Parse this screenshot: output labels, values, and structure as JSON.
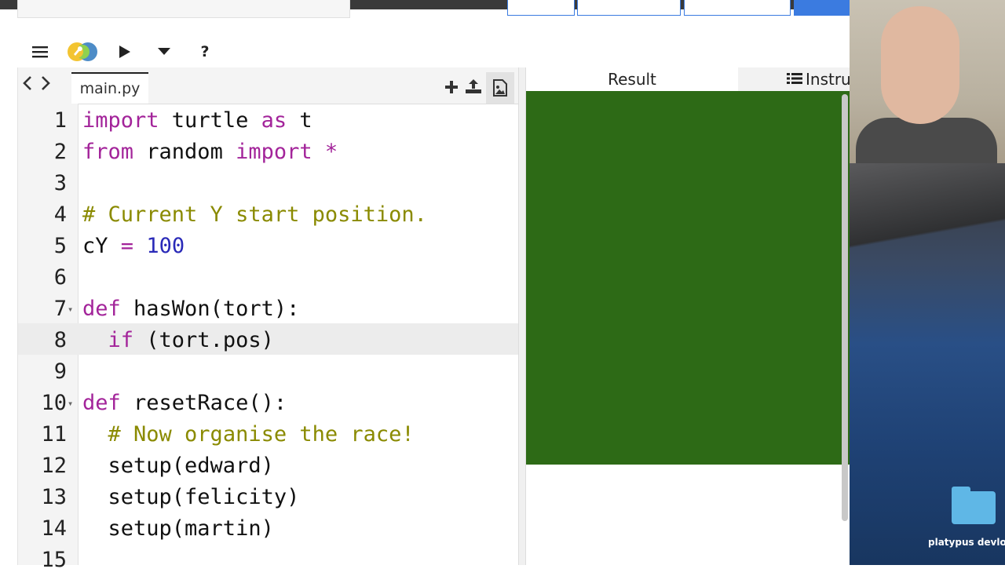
{
  "editor": {
    "filename": "main.py",
    "lines": [
      {
        "n": "1",
        "code": "import turtle as t"
      },
      {
        "n": "2",
        "code": "from random import *"
      },
      {
        "n": "3",
        "code": ""
      },
      {
        "n": "4",
        "code": "# Current Y start position."
      },
      {
        "n": "5",
        "code": "cY = 100"
      },
      {
        "n": "6",
        "code": ""
      },
      {
        "n": "7",
        "code": "def hasWon(tort):"
      },
      {
        "n": "8",
        "code": "  if (tort.pos)"
      },
      {
        "n": "9",
        "code": ""
      },
      {
        "n": "10",
        "code": "def resetRace():"
      },
      {
        "n": "11",
        "code": "  # Now organise the race!"
      },
      {
        "n": "12",
        "code": "  setup(edward)"
      },
      {
        "n": "13",
        "code": "  setup(felicity)"
      },
      {
        "n": "14",
        "code": "  setup(martin)"
      },
      {
        "n": "15",
        "code": ""
      }
    ]
  },
  "result_panel": {
    "tab_result": "Result",
    "tab_instructions": "Instru",
    "canvas_color": "#2d6a16"
  },
  "desktop": {
    "folder_label": "platypus devlo"
  },
  "icons": {
    "menu": "hamburger-icon",
    "run": "play-icon",
    "dropdown": "caret-down-icon",
    "help": "question-icon"
  }
}
